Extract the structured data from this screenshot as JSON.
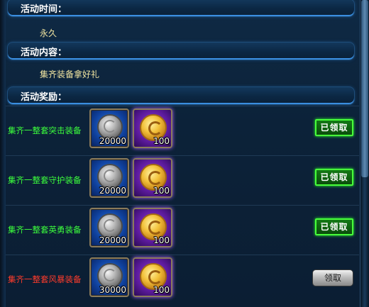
{
  "sections": {
    "time": {
      "title": "活动时间：",
      "text": "永久"
    },
    "content": {
      "title": "活动内容：",
      "text": "集齐装备拿好礼"
    },
    "reward": {
      "title": "活动奖励："
    }
  },
  "rewards": [
    {
      "label": "集齐一整套突击装备",
      "label_color": "#3cff3c",
      "items": [
        {
          "icon": "silver-coin-icon",
          "qty": "20000"
        },
        {
          "icon": "gold-coin-icon",
          "qty": "100"
        }
      ],
      "button": "已领取",
      "status": "claimed"
    },
    {
      "label": "集齐一整套守护装备",
      "label_color": "#3cff3c",
      "items": [
        {
          "icon": "silver-coin-icon",
          "qty": "20000"
        },
        {
          "icon": "gold-coin-icon",
          "qty": "100"
        }
      ],
      "button": "已领取",
      "status": "claimed"
    },
    {
      "label": "集齐一整套英勇装备",
      "label_color": "#3cff3c",
      "items": [
        {
          "icon": "silver-coin-icon",
          "qty": "20000"
        },
        {
          "icon": "gold-coin-icon",
          "qty": "100"
        }
      ],
      "button": "已领取",
      "status": "claimed"
    },
    {
      "label": "集齐一整套风暴装备",
      "label_color": "#ff3b2b",
      "items": [
        {
          "icon": "silver-coin-icon",
          "qty": "30000"
        },
        {
          "icon": "gold-coin-icon",
          "qty": "100"
        }
      ],
      "button": "领取",
      "status": "available"
    }
  ]
}
